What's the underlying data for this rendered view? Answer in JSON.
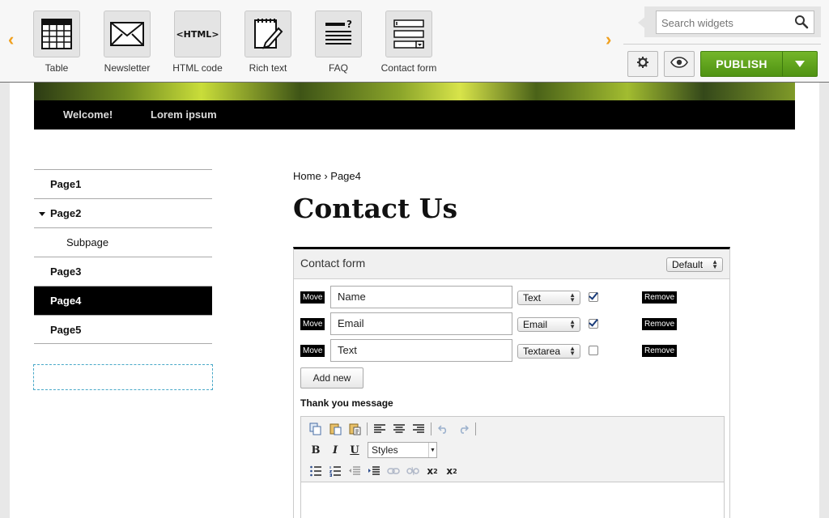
{
  "toolbar": {
    "widgets": [
      {
        "label": "Table",
        "icon": "table-icon"
      },
      {
        "label": "Newsletter",
        "icon": "envelope-icon"
      },
      {
        "label": "HTML code",
        "icon": "html-code-icon",
        "icon_text": "<HTML>"
      },
      {
        "label": "Rich text",
        "icon": "rich-text-icon"
      },
      {
        "label": "FAQ",
        "icon": "faq-icon"
      },
      {
        "label": "Contact form",
        "icon": "contact-form-icon"
      }
    ],
    "search_placeholder": "Search widgets",
    "publish_label": "PUBLISH",
    "colors": {
      "arrow": "#f0a01e",
      "publish": "#5fa31c"
    }
  },
  "site": {
    "nav": [
      "Welcome!",
      "Lorem ipsum"
    ],
    "menu": [
      {
        "label": "Page1",
        "active": false,
        "sub": false
      },
      {
        "label": "Page2",
        "active": false,
        "sub": false,
        "expanded": true
      },
      {
        "label": "Subpage",
        "active": false,
        "sub": true
      },
      {
        "label": "Page3",
        "active": false,
        "sub": false
      },
      {
        "label": "Page4",
        "active": true,
        "sub": false
      },
      {
        "label": "Page5",
        "active": false,
        "sub": false
      }
    ],
    "breadcrumb": {
      "home": "Home",
      "separator": "›",
      "current": "Page4"
    },
    "title": "Contact Us"
  },
  "form": {
    "title": "Contact form",
    "style_value": "Default",
    "move_label": "Move",
    "remove_label": "Remove",
    "fields": [
      {
        "name": "Name",
        "type": "Text",
        "required": true
      },
      {
        "name": "Email",
        "type": "Email",
        "required": true
      },
      {
        "name": "Text",
        "type": "Textarea",
        "required": false
      }
    ],
    "add_new_label": "Add new",
    "thanks_label": "Thank you message",
    "editor": {
      "styles_value": "Styles"
    }
  }
}
